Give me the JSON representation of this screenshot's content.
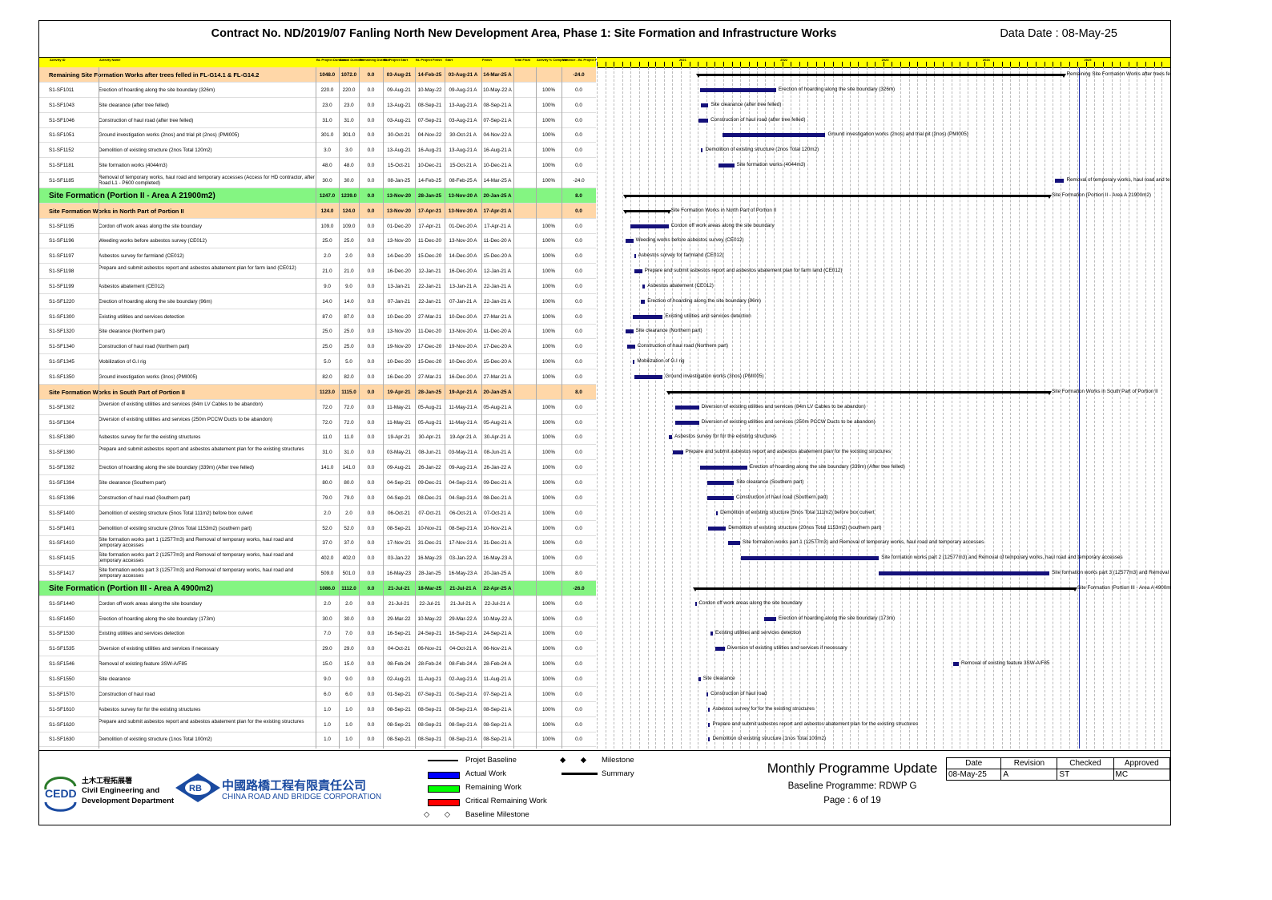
{
  "title": "Contract No. ND/2019/07 Fanling North New Development Area, Phase 1: Site Formation and Infrastructure Works",
  "data_date": "Data Date : 08-May-25",
  "columns": [
    "Activity ID",
    "Activity Name",
    "BL Project Duration",
    "Actual Duration",
    "Remaining Duration",
    "BL Project Start",
    "BL Project Finish",
    "Start",
    "Finish",
    "Total Float",
    "Activity % Complete",
    "Variance - BL Project Finish"
  ],
  "timeline_years": [
    "2021",
    "2022",
    "2023",
    "2024",
    "2025",
    "2026"
  ],
  "rows": [
    {
      "type": "sum1",
      "id": "",
      "name": "Remaining Site Formation Works after trees felled in FL-G14.1 & FL-G14.2",
      "bd": "1048.0",
      "ad": "1072.0",
      "rd": "0.0",
      "bs": "03-Aug-21",
      "bf": "14-Feb-25",
      "st": "03-Aug-21 A",
      "fi": "14-Mar-25 A",
      "tf": "",
      "pc": "",
      "vr": "-24.0"
    },
    {
      "type": "act",
      "id": "S1-SF1011",
      "name": "Erection of hoarding along the site boundary (326m)",
      "bd": "220.0",
      "ad": "220.0",
      "rd": "0.0",
      "bs": "09-Aug-21",
      "bf": "10-May-22",
      "st": "09-Aug-21 A",
      "fi": "10-May-22 A",
      "tf": "",
      "pc": "100%",
      "vr": "0.0"
    },
    {
      "type": "act",
      "id": "S1-SF1043",
      "name": "Site clearance (after tree felled)",
      "bd": "23.0",
      "ad": "23.0",
      "rd": "0.0",
      "bs": "13-Aug-21",
      "bf": "08-Sep-21",
      "st": "13-Aug-21 A",
      "fi": "08-Sep-21 A",
      "tf": "",
      "pc": "100%",
      "vr": "0.0"
    },
    {
      "type": "act",
      "id": "S1-SF1046",
      "name": "Construction of haul road (after tree felled)",
      "bd": "31.0",
      "ad": "31.0",
      "rd": "0.0",
      "bs": "03-Aug-21",
      "bf": "07-Sep-21",
      "st": "03-Aug-21 A",
      "fi": "07-Sep-21 A",
      "tf": "",
      "pc": "100%",
      "vr": "0.0"
    },
    {
      "type": "act",
      "id": "S1-SF1051",
      "name": "Ground investigation works (2nos) and trial pit (2nos) (PMI005)",
      "bd": "301.0",
      "ad": "301.0",
      "rd": "0.0",
      "bs": "30-Oct-21",
      "bf": "04-Nov-22",
      "st": "30-Oct-21 A",
      "fi": "04-Nov-22 A",
      "tf": "",
      "pc": "100%",
      "vr": "0.0"
    },
    {
      "type": "act",
      "id": "S1-SF1152",
      "name": "Demolition of existing structure (2nos Total 120m2)",
      "bd": "3.0",
      "ad": "3.0",
      "rd": "0.0",
      "bs": "13-Aug-21",
      "bf": "16-Aug-21",
      "st": "13-Aug-21 A",
      "fi": "16-Aug-21 A",
      "tf": "",
      "pc": "100%",
      "vr": "0.0"
    },
    {
      "type": "act",
      "id": "S1-SF1181",
      "name": "Site formation works (4044m3)",
      "bd": "48.0",
      "ad": "48.0",
      "rd": "0.0",
      "bs": "15-Oct-21",
      "bf": "10-Dec-21",
      "st": "15-Oct-21 A",
      "fi": "10-Dec-21 A",
      "tf": "",
      "pc": "100%",
      "vr": "0.0"
    },
    {
      "type": "act",
      "id": "S1-SF1185",
      "name": "Removal of temporary works, haul road and temporary accesses (Access for HD contractor, after Road L1 - P600 completed)",
      "bd": "30.0",
      "ad": "30.0",
      "rd": "0.0",
      "bs": "08-Jan-25",
      "bf": "14-Feb-25",
      "st": "08-Feb-25 A",
      "fi": "14-Mar-25 A",
      "tf": "",
      "pc": "100%",
      "vr": "-24.0"
    },
    {
      "type": "sum2",
      "id": "",
      "name": "Site Formation (Portion II - Area A 21900m2)",
      "bd": "1247.0",
      "ad": "1239.0",
      "rd": "0.0",
      "bs": "13-Nov-20",
      "bf": "28-Jan-25",
      "st": "13-Nov-20 A",
      "fi": "20-Jan-25 A",
      "tf": "",
      "pc": "",
      "vr": "8.0"
    },
    {
      "type": "sum1",
      "id": "",
      "name": "Site Formation Works in North Part of Portion II",
      "bd": "124.0",
      "ad": "124.0",
      "rd": "0.0",
      "bs": "13-Nov-20",
      "bf": "17-Apr-21",
      "st": "13-Nov-20 A",
      "fi": "17-Apr-21 A",
      "tf": "",
      "pc": "",
      "vr": "0.0"
    },
    {
      "type": "act",
      "id": "S1-SF1195",
      "name": "Cordon off work areas along the site boundary",
      "bd": "109.0",
      "ad": "109.0",
      "rd": "0.0",
      "bs": "01-Dec-20",
      "bf": "17-Apr-21",
      "st": "01-Dec-20 A",
      "fi": "17-Apr-21 A",
      "tf": "",
      "pc": "100%",
      "vr": "0.0"
    },
    {
      "type": "act",
      "id": "S1-SF1196",
      "name": "Weeding works before asbestos survey (CE012)",
      "bd": "25.0",
      "ad": "25.0",
      "rd": "0.0",
      "bs": "13-Nov-20",
      "bf": "11-Dec-20",
      "st": "13-Nov-20 A",
      "fi": "11-Dec-20 A",
      "tf": "",
      "pc": "100%",
      "vr": "0.0"
    },
    {
      "type": "act",
      "id": "S1-SF1197",
      "name": "Asbestos survey for farmland (CE012)",
      "bd": "2.0",
      "ad": "2.0",
      "rd": "0.0",
      "bs": "14-Dec-20",
      "bf": "15-Dec-20",
      "st": "14-Dec-20 A",
      "fi": "15-Dec-20 A",
      "tf": "",
      "pc": "100%",
      "vr": "0.0"
    },
    {
      "type": "act",
      "id": "S1-SF1198",
      "name": "Prepare and submit asbestos report and asbestos abatement plan for farm land (CE012)",
      "bd": "21.0",
      "ad": "21.0",
      "rd": "0.0",
      "bs": "16-Dec-20",
      "bf": "12-Jan-21",
      "st": "16-Dec-20 A",
      "fi": "12-Jan-21 A",
      "tf": "",
      "pc": "100%",
      "vr": "0.0"
    },
    {
      "type": "act",
      "id": "S1-SF1199",
      "name": "Asbestos abatement (CE012)",
      "bd": "9.0",
      "ad": "9.0",
      "rd": "0.0",
      "bs": "13-Jan-21",
      "bf": "22-Jan-21",
      "st": "13-Jan-21 A",
      "fi": "22-Jan-21 A",
      "tf": "",
      "pc": "100%",
      "vr": "0.0"
    },
    {
      "type": "act",
      "id": "S1-SF1220",
      "name": "Erection of hoarding along the site boundary (96m)",
      "bd": "14.0",
      "ad": "14.0",
      "rd": "0.0",
      "bs": "07-Jan-21",
      "bf": "22-Jan-21",
      "st": "07-Jan-21 A",
      "fi": "22-Jan-21 A",
      "tf": "",
      "pc": "100%",
      "vr": "0.0"
    },
    {
      "type": "act",
      "id": "S1-SF1300",
      "name": "Existing utilities and services detection",
      "bd": "87.0",
      "ad": "87.0",
      "rd": "0.0",
      "bs": "10-Dec-20",
      "bf": "27-Mar-21",
      "st": "10-Dec-20 A",
      "fi": "27-Mar-21 A",
      "tf": "",
      "pc": "100%",
      "vr": "0.0"
    },
    {
      "type": "act",
      "id": "S1-SF1320",
      "name": "Site clearance (Northern part)",
      "bd": "25.0",
      "ad": "25.0",
      "rd": "0.0",
      "bs": "13-Nov-20",
      "bf": "11-Dec-20",
      "st": "13-Nov-20 A",
      "fi": "11-Dec-20 A",
      "tf": "",
      "pc": "100%",
      "vr": "0.0"
    },
    {
      "type": "act",
      "id": "S1-SF1340",
      "name": "Construction of haul road (Northern part)",
      "bd": "25.0",
      "ad": "25.0",
      "rd": "0.0",
      "bs": "19-Nov-20",
      "bf": "17-Dec-20",
      "st": "19-Nov-20 A",
      "fi": "17-Dec-20 A",
      "tf": "",
      "pc": "100%",
      "vr": "0.0"
    },
    {
      "type": "act",
      "id": "S1-SF1345",
      "name": "Mobilization of G.I rig",
      "bd": "5.0",
      "ad": "5.0",
      "rd": "0.0",
      "bs": "10-Dec-20",
      "bf": "15-Dec-20",
      "st": "10-Dec-20 A",
      "fi": "15-Dec-20 A",
      "tf": "",
      "pc": "100%",
      "vr": "0.0"
    },
    {
      "type": "act",
      "id": "S1-SF1350",
      "name": "Ground investigation works (3nos) (PMI005)",
      "bd": "82.0",
      "ad": "82.0",
      "rd": "0.0",
      "bs": "16-Dec-20",
      "bf": "27-Mar-21",
      "st": "16-Dec-20 A",
      "fi": "27-Mar-21 A",
      "tf": "",
      "pc": "100%",
      "vr": "0.0"
    },
    {
      "type": "sum1",
      "id": "",
      "name": "Site Formation Works in South Part of Portion II",
      "bd": "1123.0",
      "ad": "1115.0",
      "rd": "0.0",
      "bs": "19-Apr-21",
      "bf": "28-Jan-25",
      "st": "19-Apr-21 A",
      "fi": "20-Jan-25 A",
      "tf": "",
      "pc": "",
      "vr": "8.0"
    },
    {
      "type": "act",
      "id": "S1-SF1302",
      "name": "Diversion of existing utilities and services (84m LV Cables to be abandon)",
      "bd": "72.0",
      "ad": "72.0",
      "rd": "0.0",
      "bs": "11-May-21",
      "bf": "05-Aug-21",
      "st": "11-May-21 A",
      "fi": "05-Aug-21 A",
      "tf": "",
      "pc": "100%",
      "vr": "0.0"
    },
    {
      "type": "act",
      "id": "S1-SF1304",
      "name": "Diversion of existing utilities and services (250m PCCW Ducts to be abandon)",
      "bd": "72.0",
      "ad": "72.0",
      "rd": "0.0",
      "bs": "11-May-21",
      "bf": "05-Aug-21",
      "st": "11-May-21 A",
      "fi": "05-Aug-21 A",
      "tf": "",
      "pc": "100%",
      "vr": "0.0"
    },
    {
      "type": "act",
      "id": "S1-SF1380",
      "name": "Asbestos survey for for the existing structures",
      "bd": "11.0",
      "ad": "11.0",
      "rd": "0.0",
      "bs": "19-Apr-21",
      "bf": "30-Apr-21",
      "st": "19-Apr-21 A",
      "fi": "30-Apr-21 A",
      "tf": "",
      "pc": "100%",
      "vr": "0.0"
    },
    {
      "type": "act",
      "id": "S1-SF1390",
      "name": "Prepare and submit asbestos report and asbestos abatement plan for the existing structures",
      "bd": "31.0",
      "ad": "31.0",
      "rd": "0.0",
      "bs": "03-May-21",
      "bf": "08-Jun-21",
      "st": "03-May-21 A",
      "fi": "08-Jun-21 A",
      "tf": "",
      "pc": "100%",
      "vr": "0.0"
    },
    {
      "type": "act",
      "id": "S1-SF1392",
      "name": "Erection of hoarding along the site boundary (339m) (After tree felled)",
      "bd": "141.0",
      "ad": "141.0",
      "rd": "0.0",
      "bs": "09-Aug-21",
      "bf": "26-Jan-22",
      "st": "09-Aug-21 A",
      "fi": "26-Jan-22 A",
      "tf": "",
      "pc": "100%",
      "vr": "0.0"
    },
    {
      "type": "act",
      "id": "S1-SF1394",
      "name": "Site clearance (Southern part)",
      "bd": "80.0",
      "ad": "80.0",
      "rd": "0.0",
      "bs": "04-Sep-21",
      "bf": "09-Dec-21",
      "st": "04-Sep-21 A",
      "fi": "09-Dec-21 A",
      "tf": "",
      "pc": "100%",
      "vr": "0.0"
    },
    {
      "type": "act",
      "id": "S1-SF1396",
      "name": "Construction of haul road (Southern part)",
      "bd": "79.0",
      "ad": "79.0",
      "rd": "0.0",
      "bs": "04-Sep-21",
      "bf": "08-Dec-21",
      "st": "04-Sep-21 A",
      "fi": "08-Dec-21 A",
      "tf": "",
      "pc": "100%",
      "vr": "0.0"
    },
    {
      "type": "act",
      "id": "S1-SF1400",
      "name": "Demolition of existing structure (5nos Total 111m2) before box culvert",
      "bd": "2.0",
      "ad": "2.0",
      "rd": "0.0",
      "bs": "06-Oct-21",
      "bf": "07-Oct-21",
      "st": "06-Oct-21 A",
      "fi": "07-Oct-21 A",
      "tf": "",
      "pc": "100%",
      "vr": "0.0"
    },
    {
      "type": "act",
      "id": "S1-SF1401",
      "name": "Demolition of existing structure (20nos Total 1153m2) (southern part)",
      "bd": "52.0",
      "ad": "52.0",
      "rd": "0.0",
      "bs": "08-Sep-21",
      "bf": "10-Nov-21",
      "st": "08-Sep-21 A",
      "fi": "10-Nov-21 A",
      "tf": "",
      "pc": "100%",
      "vr": "0.0"
    },
    {
      "type": "act",
      "id": "S1-SF1410",
      "name": "Site formation works part 1 (12577m3) and Removal of temporary works, haul road and temporary accesses",
      "bd": "37.0",
      "ad": "37.0",
      "rd": "0.0",
      "bs": "17-Nov-21",
      "bf": "31-Dec-21",
      "st": "17-Nov-21 A",
      "fi": "31-Dec-21 A",
      "tf": "",
      "pc": "100%",
      "vr": "0.0"
    },
    {
      "type": "act",
      "id": "S1-SF1415",
      "name": "Site formation works part 2 (12577m3) and Removal of temporary works, haul road and temporary accesses",
      "bd": "402.0",
      "ad": "402.0",
      "rd": "0.0",
      "bs": "03-Jan-22",
      "bf": "16-May-23",
      "st": "03-Jan-22 A",
      "fi": "16-May-23 A",
      "tf": "",
      "pc": "100%",
      "vr": "0.0"
    },
    {
      "type": "act",
      "id": "S1-SF1417",
      "name": "Site formation works part 3 (12577m3) and Removal of temporary works, haul road and temporary accesses",
      "bd": "509.0",
      "ad": "501.0",
      "rd": "0.0",
      "bs": "16-May-23",
      "bf": "28-Jan-25",
      "st": "16-May-23 A",
      "fi": "20-Jan-25 A",
      "tf": "",
      "pc": "100%",
      "vr": "8.0"
    },
    {
      "type": "sum2",
      "id": "",
      "name": "Site Formation (Portion III - Area A 4900m2)",
      "bd": "1086.0",
      "ad": "1112.0",
      "rd": "0.0",
      "bs": "21-Jul-21",
      "bf": "18-Mar-25",
      "st": "21-Jul-21 A",
      "fi": "22-Apr-25 A",
      "tf": "",
      "pc": "",
      "vr": "-26.0"
    },
    {
      "type": "act",
      "id": "S1-SF1440",
      "name": "Cordon off work areas along the site boundary",
      "bd": "2.0",
      "ad": "2.0",
      "rd": "0.0",
      "bs": "21-Jul-21",
      "bf": "22-Jul-21",
      "st": "21-Jul-21 A",
      "fi": "22-Jul-21 A",
      "tf": "",
      "pc": "100%",
      "vr": "0.0"
    },
    {
      "type": "act",
      "id": "S1-SF1450",
      "name": "Erection of hoarding along the site boundary (173m)",
      "bd": "30.0",
      "ad": "30.0",
      "rd": "0.0",
      "bs": "29-Mar-22",
      "bf": "10-May-22",
      "st": "29-Mar-22 A",
      "fi": "10-May-22 A",
      "tf": "",
      "pc": "100%",
      "vr": "0.0"
    },
    {
      "type": "act",
      "id": "S1-SF1530",
      "name": "Existing utilities and services detection",
      "bd": "7.0",
      "ad": "7.0",
      "rd": "0.0",
      "bs": "16-Sep-21",
      "bf": "24-Sep-21",
      "st": "16-Sep-21 A",
      "fi": "24-Sep-21 A",
      "tf": "",
      "pc": "100%",
      "vr": "0.0"
    },
    {
      "type": "act",
      "id": "S1-SF1535",
      "name": "Diversion of existing utilities and services if necessary",
      "bd": "29.0",
      "ad": "29.0",
      "rd": "0.0",
      "bs": "04-Oct-21",
      "bf": "06-Nov-21",
      "st": "04-Oct-21 A",
      "fi": "06-Nov-21 A",
      "tf": "",
      "pc": "100%",
      "vr": "0.0"
    },
    {
      "type": "act",
      "id": "S1-SF1546",
      "name": "Removal of existing feature 3SW-A/F85",
      "bd": "15.0",
      "ad": "15.0",
      "rd": "0.0",
      "bs": "08-Feb-24",
      "bf": "28-Feb-24",
      "st": "08-Feb-24 A",
      "fi": "28-Feb-24 A",
      "tf": "",
      "pc": "100%",
      "vr": "0.0"
    },
    {
      "type": "act",
      "id": "S1-SF1550",
      "name": "Site clearance",
      "bd": "9.0",
      "ad": "9.0",
      "rd": "0.0",
      "bs": "02-Aug-21",
      "bf": "11-Aug-21",
      "st": "02-Aug-21 A",
      "fi": "11-Aug-21 A",
      "tf": "",
      "pc": "100%",
      "vr": "0.0"
    },
    {
      "type": "act",
      "id": "S1-SF1570",
      "name": "Construction of haul road",
      "bd": "6.0",
      "ad": "6.0",
      "rd": "0.0",
      "bs": "01-Sep-21",
      "bf": "07-Sep-21",
      "st": "01-Sep-21 A",
      "fi": "07-Sep-21 A",
      "tf": "",
      "pc": "100%",
      "vr": "0.0"
    },
    {
      "type": "act",
      "id": "S1-SF1610",
      "name": "Asbestos survey for for the existing structures",
      "bd": "1.0",
      "ad": "1.0",
      "rd": "0.0",
      "bs": "08-Sep-21",
      "bf": "08-Sep-21",
      "st": "08-Sep-21 A",
      "fi": "08-Sep-21 A",
      "tf": "",
      "pc": "100%",
      "vr": "0.0"
    },
    {
      "type": "act",
      "id": "S1-SF1620",
      "name": "Prepare and submit asbestos report and asbestos abatement plan for the existing structures",
      "bd": "1.0",
      "ad": "1.0",
      "rd": "0.0",
      "bs": "08-Sep-21",
      "bf": "08-Sep-21",
      "st": "08-Sep-21 A",
      "fi": "08-Sep-21 A",
      "tf": "",
      "pc": "100%",
      "vr": "0.0"
    },
    {
      "type": "act",
      "id": "S1-SF1630",
      "name": "Demolition of existing structure (1nos Total 100m2)",
      "bd": "1.0",
      "ad": "1.0",
      "rd": "0.0",
      "bs": "08-Sep-21",
      "bf": "08-Sep-21",
      "st": "08-Sep-21 A",
      "fi": "08-Sep-21 A",
      "tf": "",
      "pc": "100%",
      "vr": "0.0"
    }
  ],
  "legend": {
    "baseline": "Projet Baseline",
    "actual": "Actual Work",
    "remaining": "Remaining Work",
    "critical": "Critical Remaining Work",
    "baseline_milestone": "Baseline Milestone",
    "milestone": "Milestone",
    "summary": "Summary",
    "colors": {
      "actual": "#0000ff",
      "remaining": "#00ff00",
      "critical": "#ff0000",
      "summary": "#000000",
      "data_date": "#1a2aa8"
    }
  },
  "logos": {
    "cedd_abbr": "CEDD",
    "cedd_cn": "土木工程拓展署",
    "cedd_en1": "Civil Engineering and",
    "cedd_en2": "Development Department",
    "crbc_abbr": "RB",
    "crbc_cn": "中國路橋工程有限責任公司",
    "crbc_en": "CHINA ROAD AND BRIDGE CORPORATION"
  },
  "report": {
    "title": "Monthly Programme Update",
    "baseline": "Baseline Programme: RDWP G",
    "page": "Page : 6 of 19"
  },
  "signoff": {
    "headers": [
      "Date",
      "Revision",
      "Checked",
      "Approved"
    ],
    "values": [
      "08-May-25",
      "A",
      "ST",
      "MC"
    ]
  }
}
